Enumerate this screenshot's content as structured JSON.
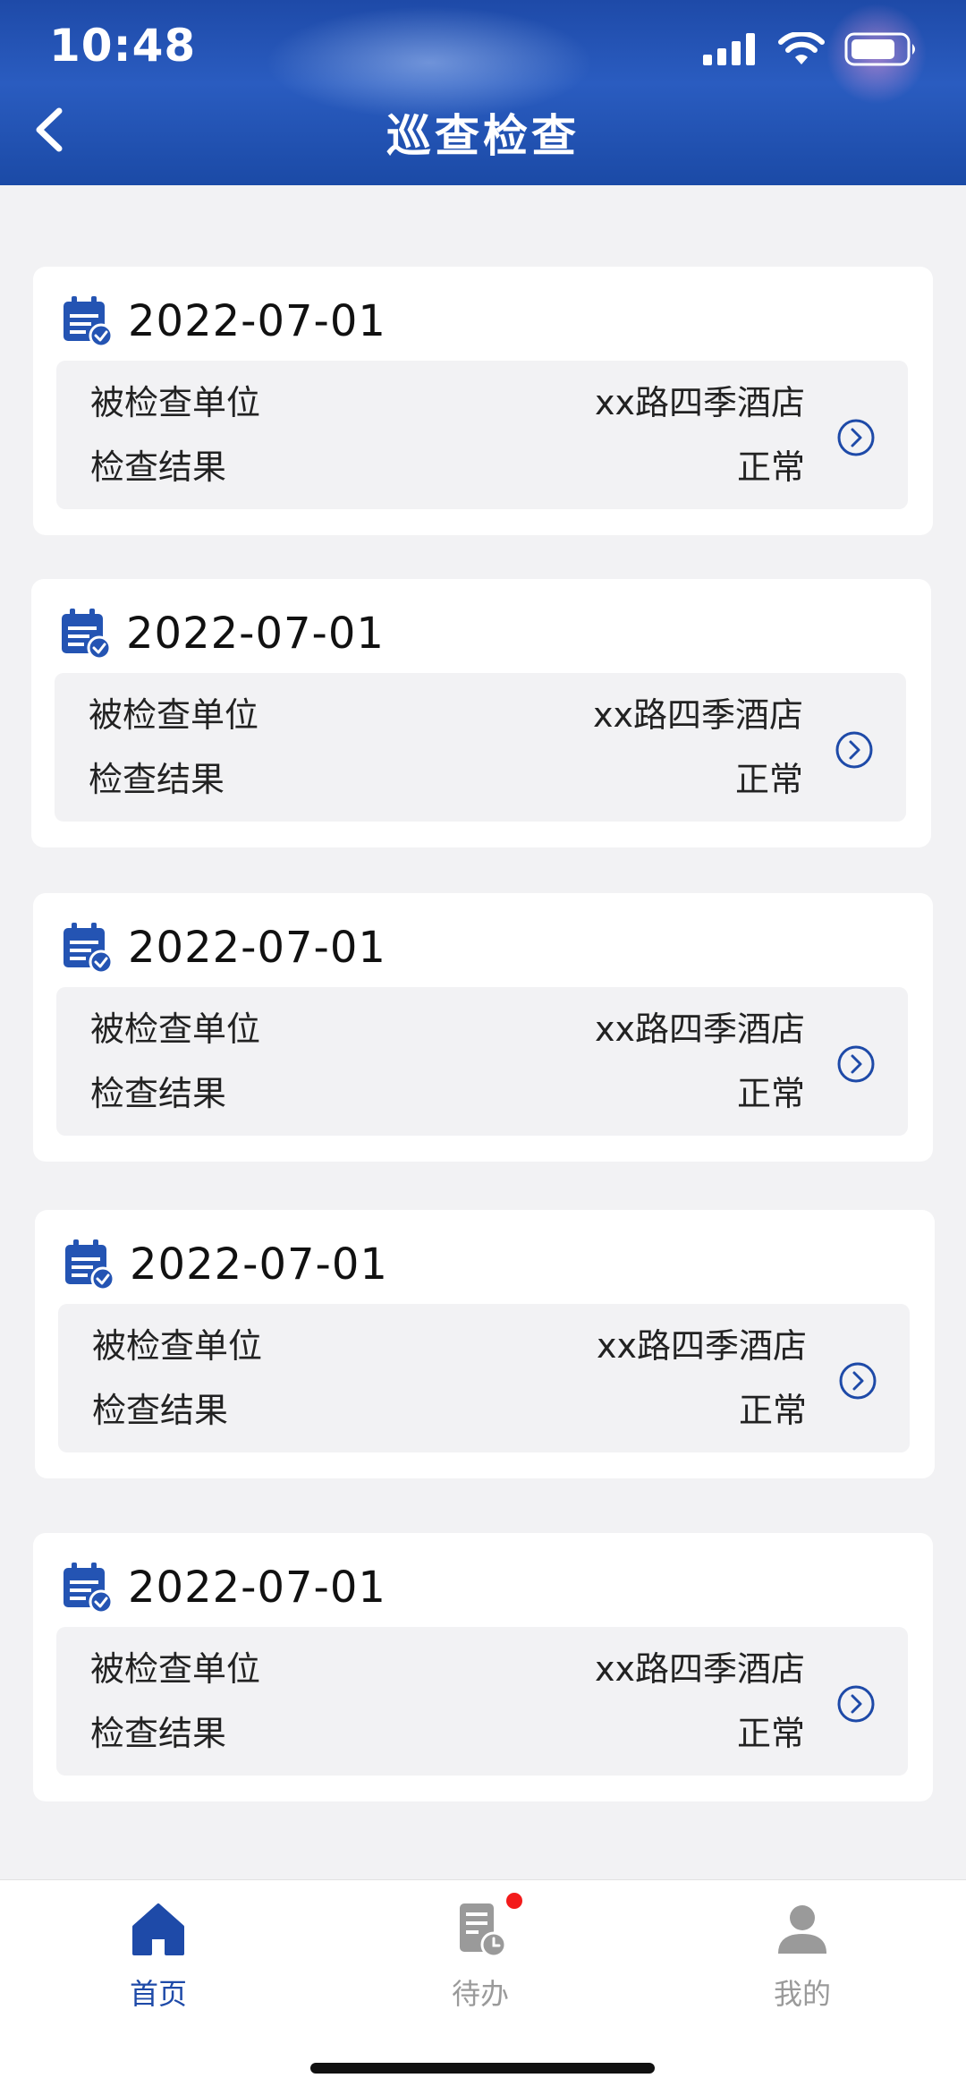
{
  "status_bar": {
    "time": "10:48"
  },
  "header": {
    "title": "巡查检查"
  },
  "records": [
    {
      "date": "2022-07-01",
      "unit_label": "被检查单位",
      "unit_value": "xx路四季酒店",
      "result_label": "检查结果",
      "result_value": "正常"
    },
    {
      "date": "2022-07-01",
      "unit_label": "被检查单位",
      "unit_value": "xx路四季酒店",
      "result_label": "检查结果",
      "result_value": "正常"
    },
    {
      "date": "2022-07-01",
      "unit_label": "被检查单位",
      "unit_value": "xx路四季酒店",
      "result_label": "检查结果",
      "result_value": "正常"
    },
    {
      "date": "2022-07-01",
      "unit_label": "被检查单位",
      "unit_value": "xx路四季酒店",
      "result_label": "检查结果",
      "result_value": "正常"
    },
    {
      "date": "2022-07-01",
      "unit_label": "被检查单位",
      "unit_value": "xx路四季酒店",
      "result_label": "检查结果",
      "result_value": "正常"
    }
  ],
  "tabbar": {
    "items": [
      {
        "label": "首页",
        "icon": "home-icon",
        "active": true
      },
      {
        "label": "待办",
        "icon": "todo-icon",
        "active": false,
        "badge": true
      },
      {
        "label": "我的",
        "icon": "profile-icon",
        "active": false
      }
    ]
  },
  "colors": {
    "primary": "#1e4aa8",
    "badge": "#f31b1b",
    "inactive": "#9a9a9a"
  }
}
